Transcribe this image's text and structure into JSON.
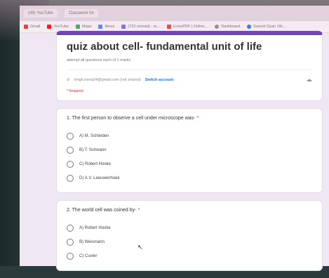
{
  "browser": {
    "tabs": [
      "(49) YouTube",
      "Classwork for"
    ],
    "bookmarks": [
      "Gmail",
      "YouTube",
      "Maps",
      "News",
      "(723 unread) - ro...",
      "iLovePDF | Online...",
      "Dashboard",
      "Suresh Gyan Vih..."
    ]
  },
  "form": {
    "title": "quiz  about cell- fundamental unit of life",
    "description": "attempt all  questions each of 1 marks",
    "account_email": "singh.roma24@gmail.com (not shared)",
    "switch_account": "Switch account",
    "required_note": "* Required",
    "questions": [
      {
        "text": "1. The first person to observe a cell under microscope was-",
        "required_mark": "*",
        "options": [
          "A) M. Schleiden",
          "B) T. Schwann",
          "C) Robert Hooke",
          "D) A.V. Leeuwenhoek"
        ]
      },
      {
        "text": "2. The world cell was coined by-",
        "required_mark": "*",
        "options": [
          "A) Robert Hooke",
          "B) Weismann",
          "C) Cuvier"
        ]
      }
    ]
  },
  "colors": {
    "accent": "#673ab7",
    "link": "#1a73e8",
    "required": "#d93025"
  }
}
